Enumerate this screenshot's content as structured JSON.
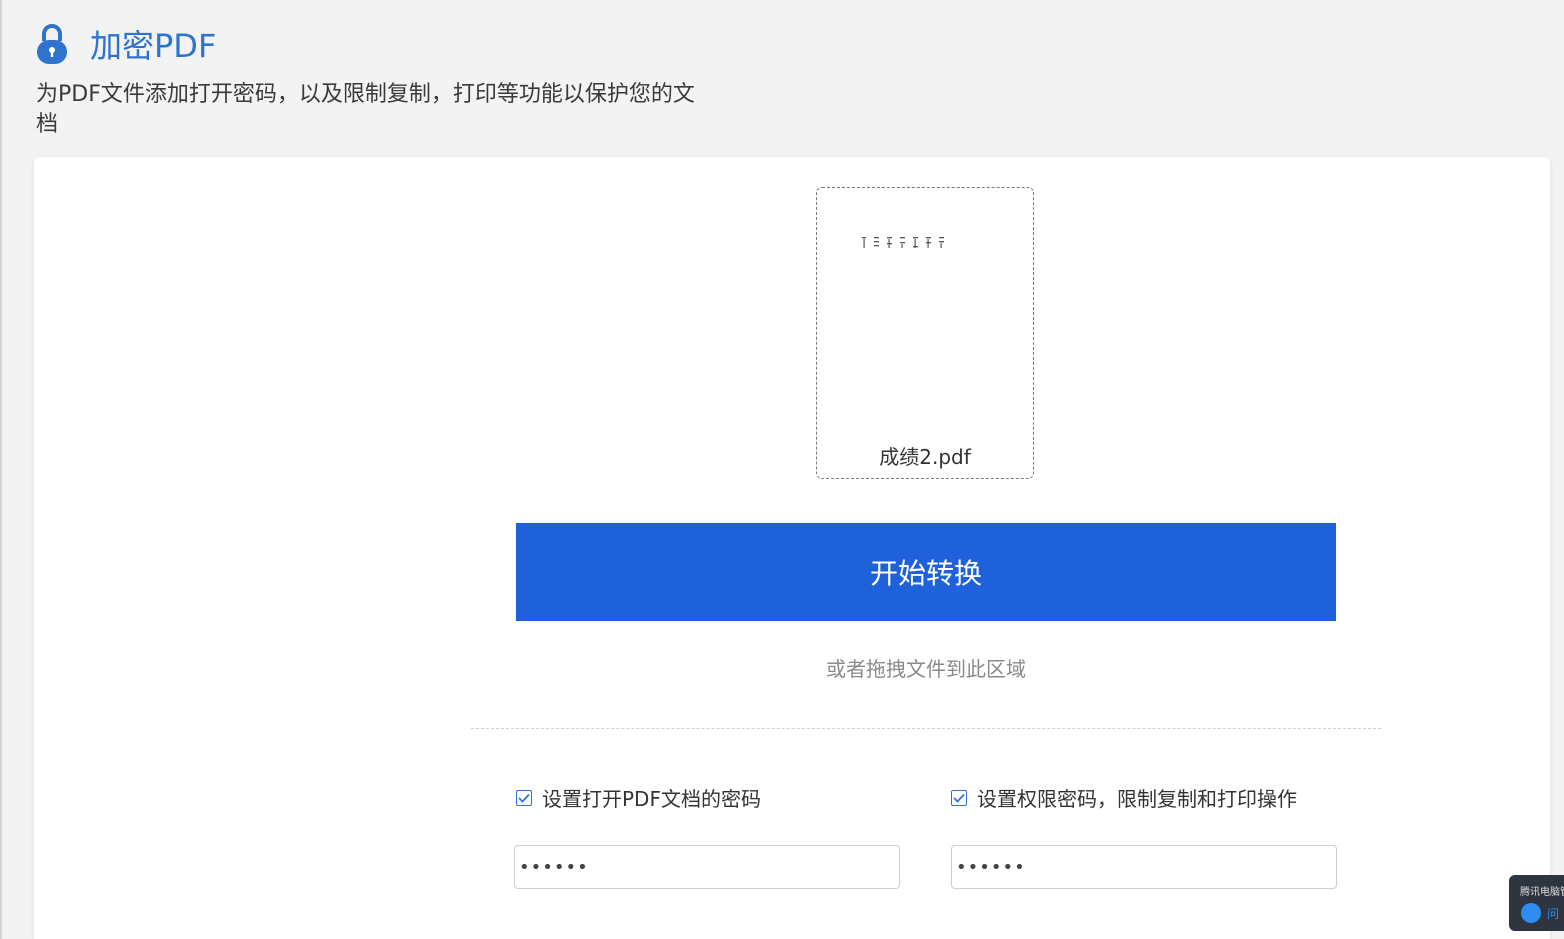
{
  "header": {
    "title": "加密PDF",
    "subtitle": "为PDF文件添加打开密码，以及限制复制，打印等功能以保护您的文档"
  },
  "file": {
    "name": "成绩2.pdf"
  },
  "actions": {
    "start_label": "开始转换",
    "drag_hint": "或者拖拽文件到此区域"
  },
  "options": {
    "open_password": {
      "label": "设置打开PDF文档的密码",
      "checked": true,
      "value": "••••••"
    },
    "permission_password": {
      "label": "设置权限密码，限制复制和打印操作",
      "checked": true,
      "value": "••••••"
    }
  },
  "widget": {
    "top_label": "腾讯电脑管",
    "bot_label": "问"
  },
  "colors": {
    "accent": "#2f73d0",
    "button": "#1f60db"
  }
}
